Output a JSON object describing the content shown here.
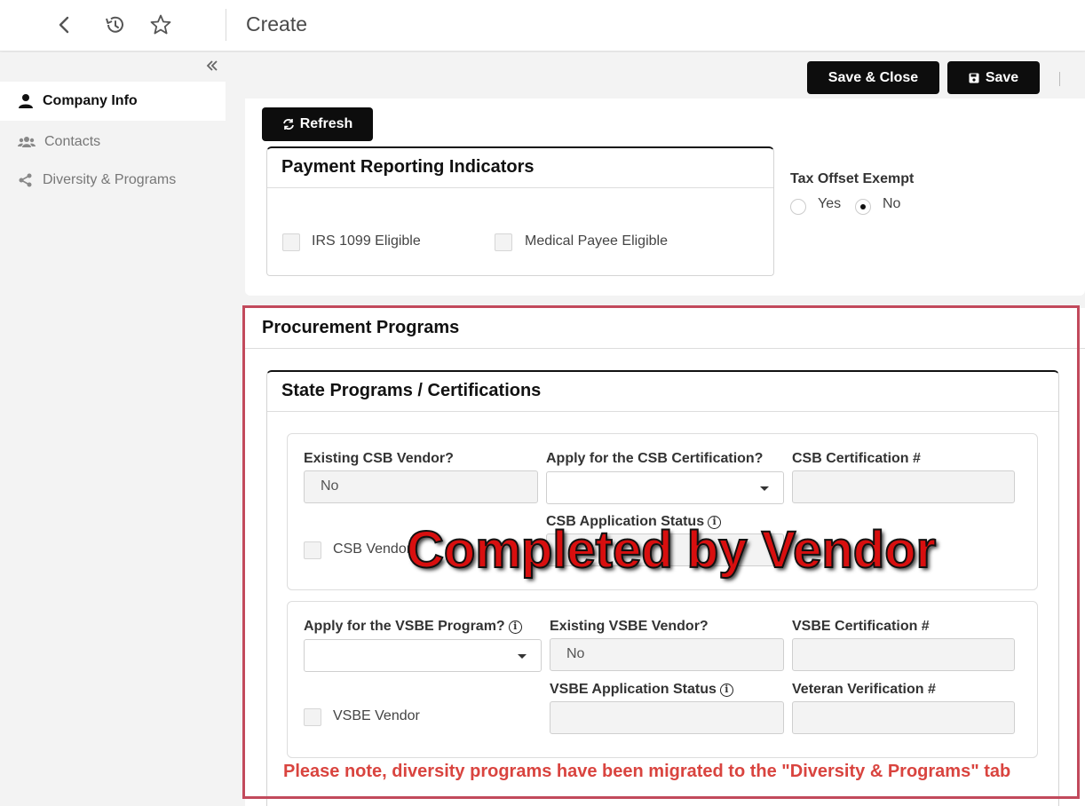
{
  "header": {
    "title": "Create"
  },
  "sidebar": {
    "items": [
      {
        "label": "Company Info",
        "icon": "user-icon",
        "active": true
      },
      {
        "label": "Contacts",
        "icon": "users-icon",
        "active": false
      },
      {
        "label": "Diversity & Programs",
        "icon": "share-icon",
        "active": false
      }
    ]
  },
  "toolbar": {
    "save_close_label": "Save & Close",
    "save_label": "Save"
  },
  "refresh_label": "Refresh",
  "payment_reporting": {
    "title": "Payment Reporting Indicators",
    "irs_label": "IRS 1099 Eligible",
    "medical_label": "Medical Payee Eligible"
  },
  "tax_offset": {
    "label": "Tax Offset Exempt",
    "yes_label": "Yes",
    "no_label": "No",
    "selected": "No"
  },
  "procurement": {
    "title": "Procurement Programs",
    "state_title": "State Programs / Certifications",
    "csb": {
      "existing_label": "Existing CSB Vendor?",
      "existing_value": "No",
      "apply_label": "Apply for the CSB Certification?",
      "cert_label": "CSB Certification #",
      "status_label": "CSB Application Status",
      "vendor_label": "CSB Vendor"
    },
    "vsbe": {
      "apply_label": "Apply for the VSBE Program?",
      "existing_label": "Existing VSBE Vendor?",
      "existing_value": "No",
      "cert_label": "VSBE Certification #",
      "vendor_label": "VSBE Vendor",
      "status_label": "VSBE Application Status",
      "veteran_label": "Veteran Verification #"
    }
  },
  "overlay_text": "Completed by Vendor",
  "note": "Please note, diversity programs have been migrated to the \"Diversity & Programs\" tab",
  "colors": {
    "accent_dark": "#0d0d0d",
    "highlight_border": "#c24a5c",
    "note_red": "#d9443f",
    "overlay_red": "#d80f0f"
  }
}
